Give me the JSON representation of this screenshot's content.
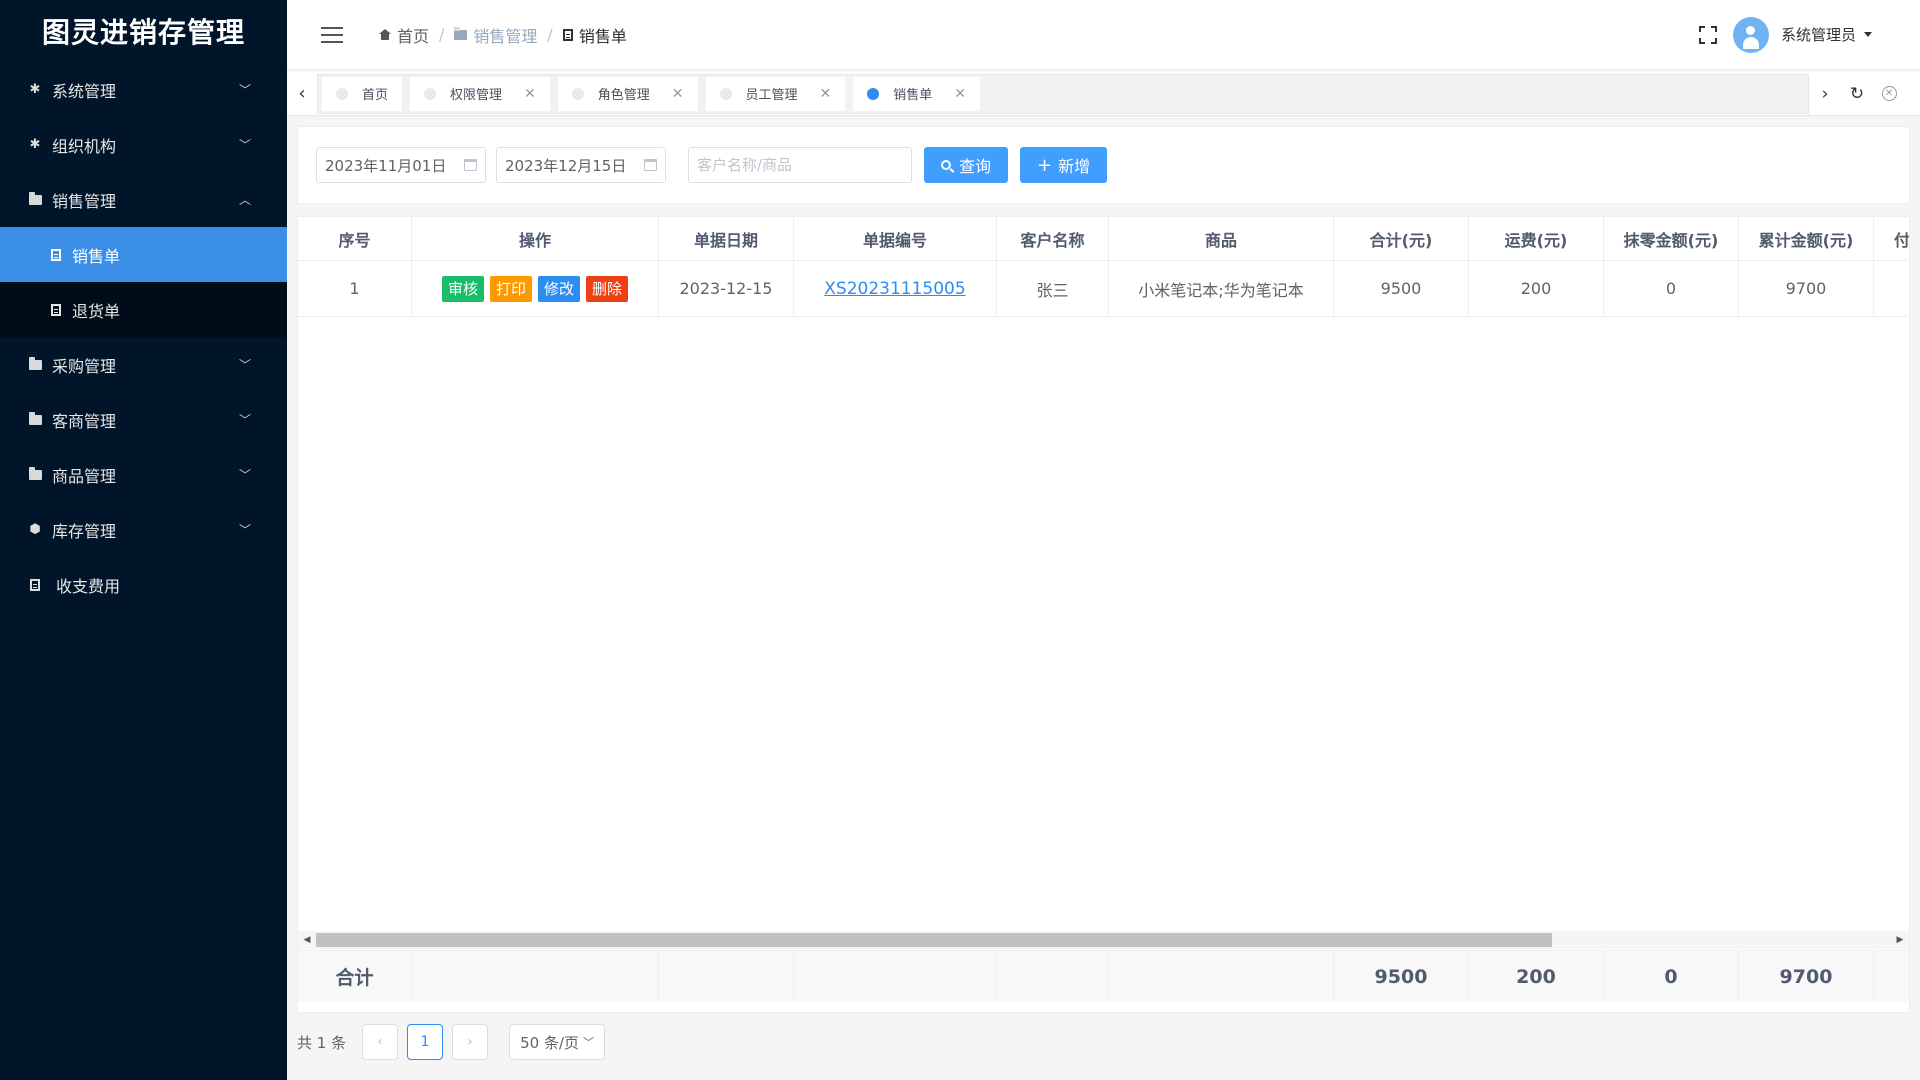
{
  "app": {
    "title": "图灵进销存管理"
  },
  "sidebar": {
    "items": [
      {
        "label": "系统管理",
        "icon": "gear-icon"
      },
      {
        "label": "组织机构",
        "icon": "gear-icon"
      },
      {
        "label": "销售管理",
        "icon": "folder-icon",
        "expanded": true,
        "children": [
          {
            "label": "销售单",
            "icon": "document-icon",
            "active": true
          },
          {
            "label": "退货单",
            "icon": "document-icon"
          }
        ]
      },
      {
        "label": "采购管理",
        "icon": "folder-icon"
      },
      {
        "label": "客商管理",
        "icon": "folder-icon"
      },
      {
        "label": "商品管理",
        "icon": "folder-icon"
      },
      {
        "label": "库存管理",
        "icon": "cube-icon"
      },
      {
        "label": "收支费用",
        "icon": "document-icon"
      }
    ]
  },
  "header": {
    "breadcrumb": [
      "首页",
      "销售管理",
      "销售单"
    ],
    "user": "系统管理员"
  },
  "tabs": [
    {
      "label": "首页",
      "closable": false
    },
    {
      "label": "权限管理",
      "closable": true
    },
    {
      "label": "角色管理",
      "closable": true
    },
    {
      "label": "员工管理",
      "closable": true
    },
    {
      "label": "销售单",
      "closable": true,
      "active": true
    }
  ],
  "search": {
    "start_date": "2023年11月01日",
    "end_date": "2023年12月15日",
    "keyword_placeholder": "客户名称/商品",
    "query_label": "查询",
    "add_label": "新增"
  },
  "table": {
    "columns": [
      "序号",
      "操作",
      "单据日期",
      "单据编号",
      "客户名称",
      "商品",
      "合计(元)",
      "运费(元)",
      "抹零金额(元)",
      "累计金额(元)",
      "付"
    ],
    "actions": [
      "审核",
      "打印",
      "修改",
      "删除"
    ],
    "rows": [
      {
        "index": "1",
        "date": "2023-12-15",
        "code": "XS20231115005",
        "customer": "张三",
        "goods": "小米笔记本;华为笔记本",
        "total": "9500",
        "freight": "200",
        "rounding": "0",
        "cumulative": "9700"
      }
    ],
    "summary": {
      "label": "合计",
      "total": "9500",
      "freight": "200",
      "rounding": "0",
      "cumulative": "9700"
    }
  },
  "pagination": {
    "total_text": "共 1 条",
    "current_page": "1",
    "page_size": "50 条/页"
  },
  "colors": {
    "primary": "#409eff",
    "sidebar_bg": "#001529",
    "active_menu": "#3a8ee6",
    "green": "#19be6b",
    "orange": "#ff9900",
    "red": "#ed4014"
  }
}
